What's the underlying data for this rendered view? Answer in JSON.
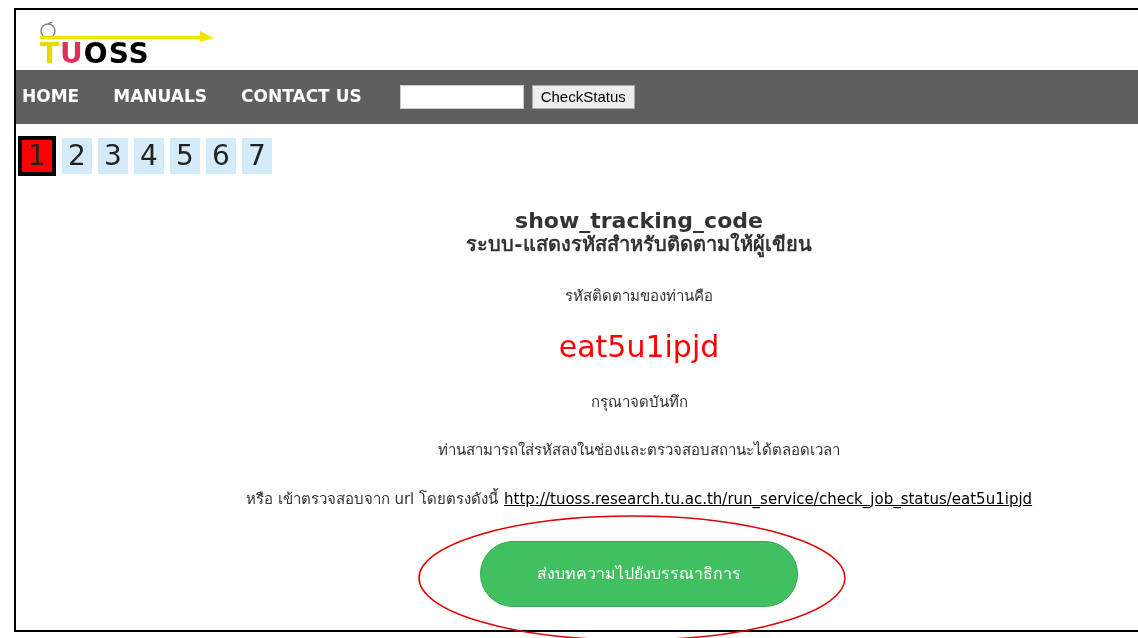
{
  "logo": {
    "parts": [
      "T",
      "U",
      "OSS"
    ]
  },
  "nav": {
    "items": [
      "HOME",
      "MANUALS",
      "CONTACT US"
    ],
    "button": "CheckStatus"
  },
  "steps": [
    {
      "label": "1",
      "selected": true
    },
    {
      "label": "2",
      "selected": false
    },
    {
      "label": "3",
      "selected": false
    },
    {
      "label": "4",
      "selected": false
    },
    {
      "label": "5",
      "selected": false
    },
    {
      "label": "6",
      "selected": false
    },
    {
      "label": "7",
      "selected": false
    }
  ],
  "content": {
    "title": "show_tracking_code",
    "subtitle": "ระบบ-แสดงรหัสสำหรับติดตามให้ผู้เขียน",
    "code_label": "รหัสติดตามของท่านคือ",
    "code": "eat5u1ipjd",
    "note": "กรุณาจดบันทึก",
    "info": "ท่านสามารถใส่รหัสลงในช่องและตรวจสอบสถานะได้ตลอดเวลา",
    "url_prefix": "หรือ เข้าตรวจสอบจาก url โดยตรงดังนี้",
    "url": "http://tuoss.research.tu.ac.th/run_service/check_job_status/eat5u1ipjd",
    "submit_button": "ส่งบทความไปยังบรรณาธิการ"
  }
}
